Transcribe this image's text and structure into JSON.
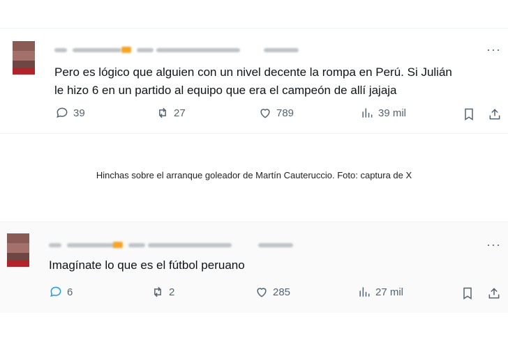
{
  "tweets": [
    {
      "text_line1": "Pero es lógico que alguien con un nivel decente la rompa en Perú. Si Julián",
      "text_line2": "le hizo 6 en un partido al equipo que era el campeón de allí jajaja",
      "replies": "39",
      "retweets": "27",
      "likes": "789",
      "views": "39 mil",
      "more": "···"
    },
    {
      "text_line1": "Imagínate lo que es el fútbol peruano",
      "replies": "6",
      "retweets": "2",
      "likes": "285",
      "views": "27 mil",
      "more": "···"
    }
  ],
  "caption": "Hinchas sobre el arranque goleador de Martín Cauteruccio. Foto: captura de X",
  "colors": {
    "accent": "#1d9bf0",
    "icon_gray": "#536471",
    "blur_orange": "#f4a429"
  },
  "icons": [
    "reply-icon",
    "retweet-icon",
    "like-icon",
    "views-icon",
    "bookmark-icon",
    "share-icon",
    "more-icon"
  ]
}
